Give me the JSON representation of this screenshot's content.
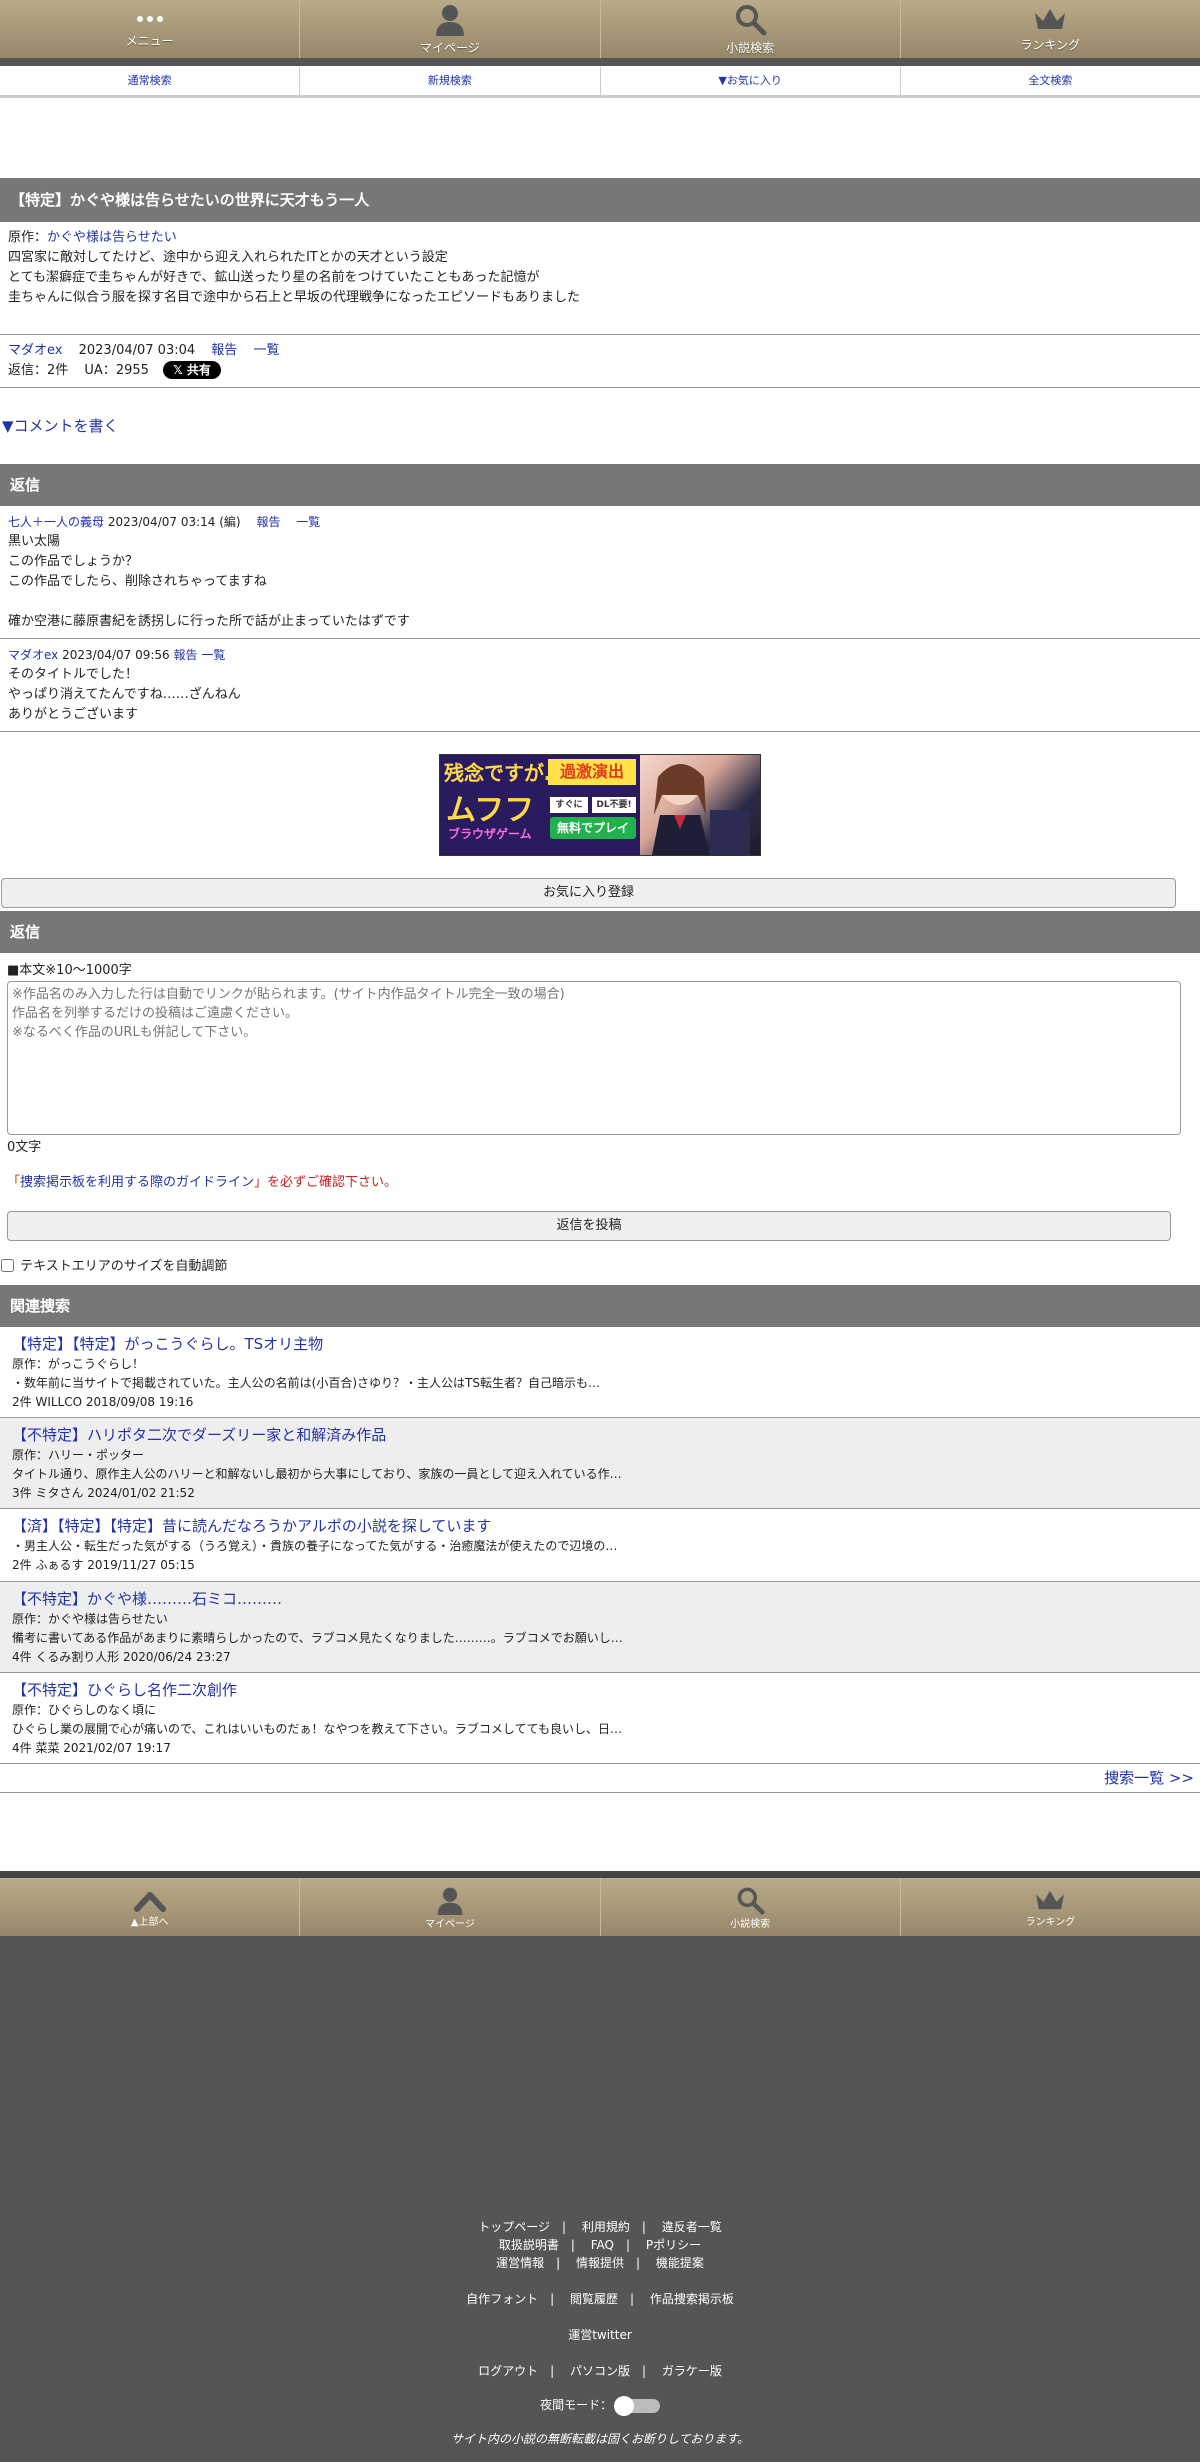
{
  "nav": {
    "items": [
      {
        "label": "メニュー",
        "icon": "menu-dots-icon"
      },
      {
        "label": "マイページ",
        "icon": "user-icon"
      },
      {
        "label": "小説検索",
        "icon": "search-icon"
      },
      {
        "label": "ランキング",
        "icon": "crown-icon"
      }
    ]
  },
  "subnav": [
    "通常検索",
    "新規検索",
    "▼お気に入り",
    "全文検索"
  ],
  "thread": {
    "title": "【特定】かぐや様は告らせたいの世界に天才もう一人",
    "original_label": "原作：",
    "original_link": "かぐや様は告らせたい",
    "lines": [
      "四宮家に敵対してたけど、途中から迎え入れられたITとかの天才という設定",
      "とても潔癖症で圭ちゃんが好きで、鉱山送ったり星の名前をつけていたこともあった記憶が",
      "圭ちゃんに似合う服を探す名目で途中から石上と早坂の代理戦争になったエピソードもありました"
    ],
    "author": "マダオex",
    "datetime": "2023/04/07 03:04",
    "report": "報告",
    "list": "一覧",
    "reply_count": "返信：2件",
    "ua": "UA：2955",
    "share": "共有"
  },
  "comment_write": "▼コメントを書く",
  "replies_header": "返信",
  "replies": [
    {
      "author": "七人＋一人の義母",
      "datetime": "2023/04/07 03:14",
      "edited": "(編)",
      "report": "報告",
      "list": "一覧",
      "lines": [
        "黒い太陽",
        "この作品でしょうか？",
        "この作品でしたら、削除されちゃってますね",
        "",
        "確か空港に藤原書紀を誘拐しに行った所で話が止まっていたはずです"
      ]
    },
    {
      "author": "マダオex",
      "datetime": "2023/04/07 09:56",
      "edited": "",
      "report": "報告",
      "list": "一覧",
      "lines": [
        "そのタイトルでした！",
        "やっぱり消えてたんですね……ざんねん",
        "ありがとうございます"
      ]
    }
  ],
  "banner": {
    "left_big": "残念ですが…",
    "left_mid": "ムフフ",
    "left_small": "ブラウザゲーム",
    "right_top": "過激演出",
    "btn1": "すぐに",
    "btn2": "DL不要!",
    "btn3": "無料でプレイ"
  },
  "favorite_button": "お気に入り登録",
  "reply_form": {
    "header": "返信",
    "body_label": "■本文※10〜1000字",
    "placeholder": "※作品名のみ入力した行は自動でリンクが貼られます。(サイト内作品タイトル完全一致の場合)\n作品名を列挙するだけの投稿はご遠慮ください。\n※なるべく作品のURLも併記して下さい。",
    "char_count": "0文字",
    "guideline_pre": "「",
    "guideline_link": "捜索掲示板を利用する際のガイドライン",
    "guideline_post": "」を必ずご確認下さい。",
    "submit": "返信を投稿",
    "autosize_label": "テキストエリアのサイズを自動調節"
  },
  "related_header": "関連捜索",
  "related": [
    {
      "title": "【特定】【特定】がっこうぐらし。TSオリ主物",
      "original": "原作：がっこうぐらし！",
      "summary": "・数年前に当サイトで掲載されていた。主人公の名前は(小百合)さゆり？・主人公はTS転生者？自己暗示も…",
      "meta": "2件 WILLCO 2018/09/08 19:16"
    },
    {
      "title": "【不特定】ハリポタ二次でダーズリー家と和解済み作品",
      "original": "原作：ハリー・ポッター",
      "summary": "タイトル通り、原作主人公のハリーと和解ないし最初から大事にしており、家族の一員として迎え入れている作…",
      "meta": "3件 ミタさん 2024/01/02 21:52"
    },
    {
      "title": "【済】【特定】【特定】昔に読んだなろうかアルポの小説を探しています",
      "original": "",
      "summary": "・男主人公・転生だった気がする（うろ覚え）・貴族の養子になってた気がする・治癒魔法が使えたので辺境の…",
      "meta": "2件 ふぁるす 2019/11/27 05:15"
    },
    {
      "title": "【不特定】かぐや様………石ミコ………",
      "original": "原作：かぐや様は告らせたい",
      "summary": "備考に書いてある作品があまりに素晴らしかったので、ラブコメ見たくなりました………。ラブコメでお願いし…",
      "meta": "4件 くるみ割り人形 2020/06/24 23:27"
    },
    {
      "title": "【不特定】ひぐらし名作二次創作",
      "original": "原作：ひぐらしのなく頃に",
      "summary": "ひぐらし業の展開で心が痛いので、これはいいものだぁ！なやつを教えて下さい。ラブコメしてても良いし、日…",
      "meta": "4件 菜菜 2021/02/07 19:17"
    }
  ],
  "search_all": "捜索一覧 >>",
  "footnav": [
    {
      "label": "▲上部へ",
      "icon": "chevron-up-icon"
    },
    {
      "label": "マイページ",
      "icon": "user-icon"
    },
    {
      "label": "小説検索",
      "icon": "search-icon"
    },
    {
      "label": "ランキング",
      "icon": "crown-icon"
    }
  ],
  "footer": {
    "row1": [
      "トップページ",
      "利用規約",
      "違反者一覧"
    ],
    "row2": [
      "取扱説明書",
      "FAQ",
      "Pポリシー"
    ],
    "row3": [
      "運営情報",
      "情報提供",
      "機能提案"
    ],
    "row4": [
      "自作フォント",
      "閲覧履歴",
      "作品捜索掲示板"
    ],
    "twitter": "運営twitter",
    "row5": [
      "ログアウト",
      "パソコン版",
      "ガラケー版"
    ],
    "night_mode": "夜間モード：",
    "copyright": "サイト内の小説の無断転載は固くお断りしております。"
  }
}
